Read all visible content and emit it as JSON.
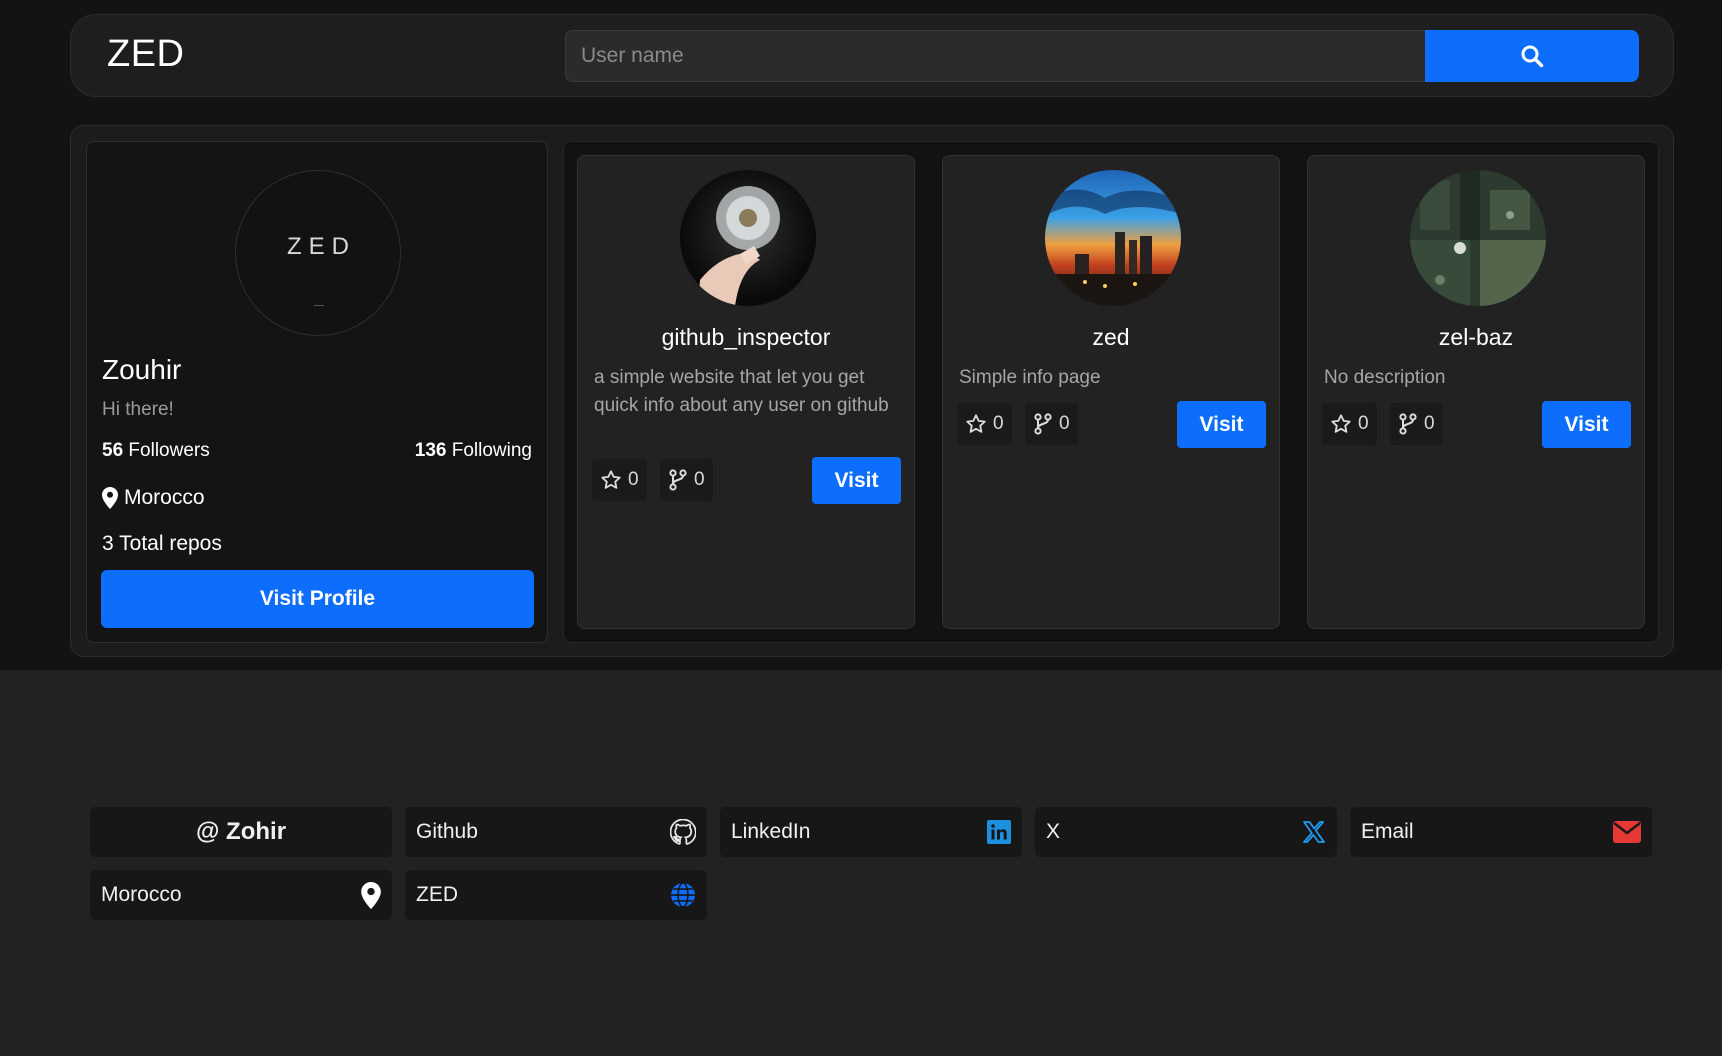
{
  "header": {
    "logo": "ZED",
    "search_placeholder": "User name"
  },
  "profile": {
    "avatar_text": "ZED",
    "name": "Zouhir",
    "bio": "Hi there!",
    "followers_count": "56",
    "followers_label": "Followers",
    "following_count": "136",
    "following_label": "Following",
    "location": "Morocco",
    "repos_text": "3 Total repos",
    "visit_label": "Visit Profile"
  },
  "repos": [
    {
      "name": "github_inspector",
      "description": "a simple website that let you get quick info about any user on github",
      "stars": "0",
      "forks": "0",
      "visit_label": "Visit"
    },
    {
      "name": "zed",
      "description": "Simple info page",
      "stars": "0",
      "forks": "0",
      "visit_label": "Visit"
    },
    {
      "name": "zel-baz",
      "description": "No description",
      "stars": "0",
      "forks": "0",
      "visit_label": "Visit"
    }
  ],
  "links": {
    "handle": "@ Zohir",
    "github": "Github",
    "linkedin": "LinkedIn",
    "x": "X",
    "email": "Email",
    "location": "Morocco",
    "website": "ZED"
  },
  "colors": {
    "accent": "#0d6efd",
    "linkedin": "#0a66c2",
    "x": "#1d9bf0",
    "email": "#e53935"
  },
  "icons": {
    "search": "search-icon",
    "location": "map-pin-icon",
    "star": "star-icon",
    "fork": "git-fork-icon",
    "github": "github-icon",
    "linkedin": "linkedin-icon",
    "x": "x-logo-icon",
    "email": "envelope-icon",
    "website": "globe-icon"
  }
}
